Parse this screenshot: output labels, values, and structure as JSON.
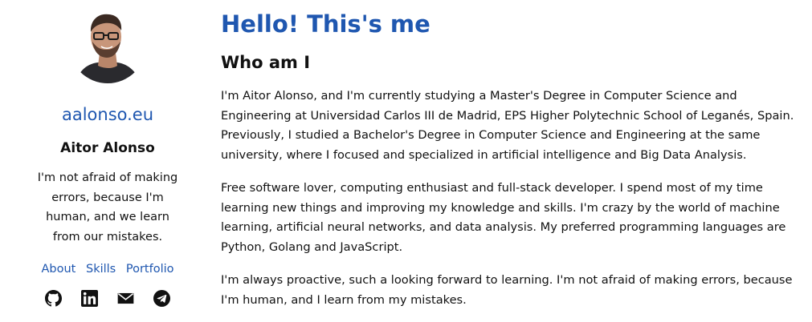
{
  "sidebar": {
    "avatar_icon": "profile-photo",
    "site_title": "aalonso.eu",
    "author_name": "Aitor Alonso",
    "author_bio": "I'm not afraid of making errors, because I'm human, and we learn from our mistakes.",
    "nav": [
      {
        "label": "About"
      },
      {
        "label": "Skills"
      },
      {
        "label": "Portfolio"
      }
    ],
    "socials": [
      {
        "icon": "github-icon"
      },
      {
        "icon": "linkedin-icon"
      },
      {
        "icon": "mail-icon"
      },
      {
        "icon": "telegram-icon"
      }
    ]
  },
  "main": {
    "title": "Hello! This's me",
    "section_title": "Who am I",
    "paragraphs": [
      "I'm Aitor Alonso, and I'm currently studying a Master's Degree in Computer Science and Engineering at Universidad Carlos III de Madrid, EPS Higher Polytechnic School of Leganés, Spain. Previously, I studied a Bachelor's Degree in Computer Science and Engineering at the same university, where I focused and specialized in artificial intelligence and Big Data Analysis.",
      "Free software lover, computing enthusiast and full-stack developer. I spend most of my time learning new things and improving my knowledge and skills. I'm crazy by the world of machine learning, artificial neural networks, and data analysis. My preferred programming languages are Python, Golang and JavaScript.",
      "I'm always proactive, such a looking forward to learning. I'm not afraid of making errors, because I'm human, and I learn from my mistakes."
    ]
  },
  "colors": {
    "accent": "#1f57b0",
    "text": "#111111",
    "background": "#ffffff"
  }
}
